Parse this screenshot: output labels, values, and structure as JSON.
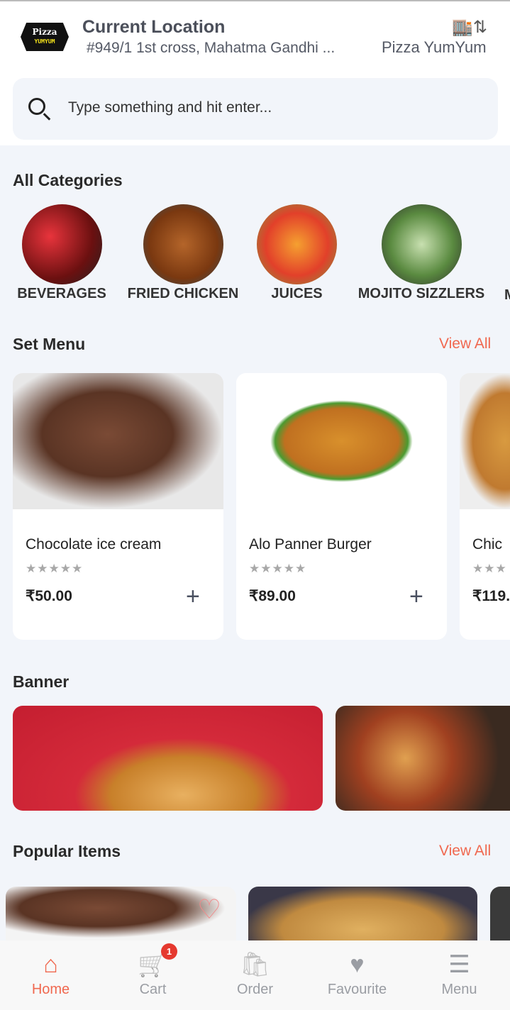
{
  "header": {
    "logo_text": "Pizza",
    "logo_sub": "YUMYUM",
    "title": "Current Location",
    "address": "#949/1 1st cross, Mahatma Gandhi ...",
    "store_icon": "store-swap-icon",
    "store_name": "Pizza YumYum"
  },
  "search": {
    "placeholder": "Type something and hit enter..."
  },
  "categories": {
    "title": "All Categories",
    "items": [
      {
        "label": "BEVERAGES"
      },
      {
        "label": "FRIED CHICKEN"
      },
      {
        "label": "JUICES"
      },
      {
        "label": "MOJITO SIZZLERS"
      },
      {
        "label": "M"
      }
    ]
  },
  "set_menu": {
    "title": "Set Menu",
    "view_all": "View All",
    "items": [
      {
        "name": "Chocolate ice cream",
        "stars": "★★★★★",
        "price": "₹50.00",
        "add": "+"
      },
      {
        "name": "Alo Panner Burger",
        "stars": "★★★★★",
        "price": "₹89.00",
        "add": "+"
      },
      {
        "name": "Chic",
        "stars": "★★★",
        "price": "₹119."
      }
    ]
  },
  "banner": {
    "title": "Banner"
  },
  "popular": {
    "title": "Popular Items",
    "view_all": "View All",
    "fav_icon": "♡"
  },
  "nav": {
    "items": [
      {
        "label": "Home",
        "icon": "⌂"
      },
      {
        "label": "Cart",
        "icon": "🛒"
      },
      {
        "label": "Order",
        "icon": "🛍"
      },
      {
        "label": "Favourite",
        "icon": "♥"
      },
      {
        "label": "Menu",
        "icon": "☰"
      }
    ],
    "cart_badge": "1",
    "active": "Home"
  },
  "colors": {
    "accent": "#f0684f",
    "badge": "#e5392f",
    "background": "#f2f5fa"
  }
}
